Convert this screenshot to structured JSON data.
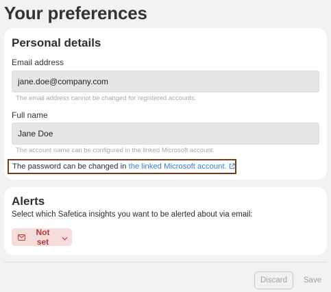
{
  "page": {
    "title": "Your preferences"
  },
  "personal": {
    "title": "Personal details",
    "email": {
      "label": "Email address",
      "value": "jane.doe@company.com",
      "helper": "The email address cannot be changed for registered accounts."
    },
    "full_name": {
      "label": "Full name",
      "value": "Jane Doe",
      "helper": "The account name can be configured in the linked Microsoft account."
    },
    "password_note": {
      "text": "The password can be changed in ",
      "link_text": "the linked Microsoft account.",
      "link_icon": "external-link-icon"
    }
  },
  "alerts": {
    "title": "Alerts",
    "description": "Select which Safetica insights you want to be alerted about via email:",
    "selector": {
      "icon": "envelope-icon",
      "label": "Not set",
      "chevron": "chevron-down-icon"
    }
  },
  "footer": {
    "discard_label": "Discard",
    "save_label": "Save"
  },
  "colors": {
    "background": "#f2f2f2",
    "card": "#ffffff",
    "input": "#e6e6e6",
    "link": "#3a7bd5",
    "highlight_border": "#7a3b1a",
    "alert_badge_bg": "#f8dcdc",
    "alert_badge_text": "#b03b3b"
  }
}
